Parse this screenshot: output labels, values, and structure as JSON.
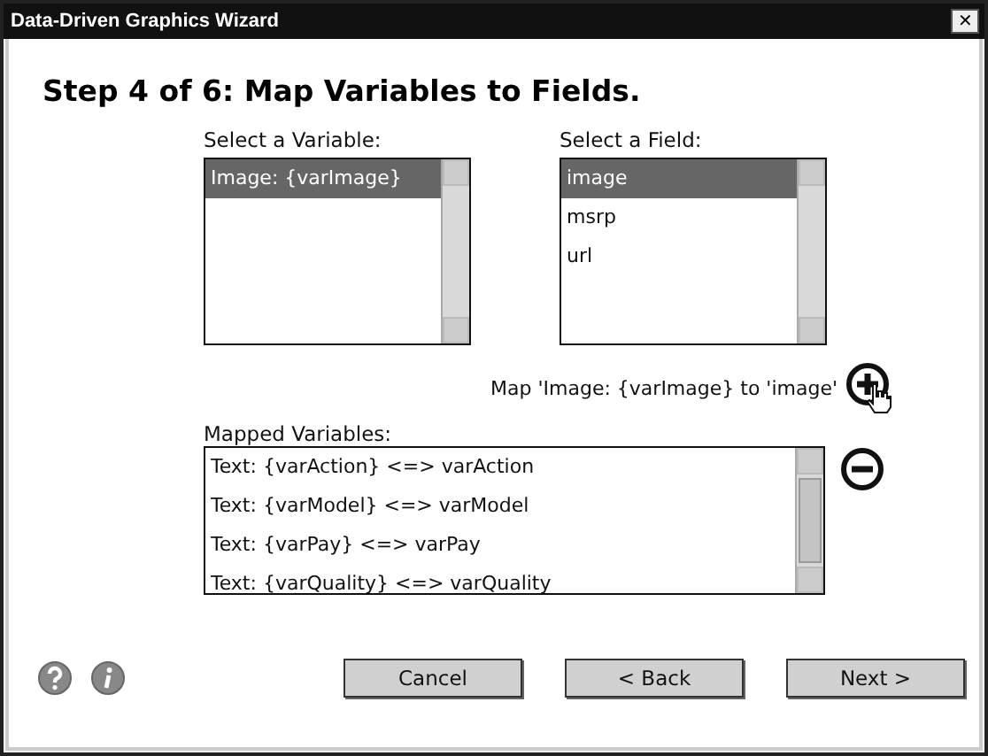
{
  "window": {
    "title": "Data-Driven Graphics Wizard",
    "close": "✕"
  },
  "heading": "Step 4 of 6: Map Variables to Fields.",
  "variables": {
    "label": "Select a Variable:",
    "items": [
      {
        "text": "Image: {varImage}",
        "selected": true
      }
    ]
  },
  "fields": {
    "label": "Select a Field:",
    "items": [
      {
        "text": "image",
        "selected": true
      },
      {
        "text": "msrp",
        "selected": false
      },
      {
        "text": "url",
        "selected": false
      }
    ]
  },
  "map_hint": "Map 'Image: {varImage} to 'image'",
  "mapped": {
    "label": "Mapped Variables:",
    "items": [
      {
        "text": "Text: {varAction} <=> varAction",
        "selected": false
      },
      {
        "text": "Text: {varModel} <=> varModel",
        "selected": false
      },
      {
        "text": "Text: {varPay} <=> varPay",
        "selected": false
      },
      {
        "text": "Text: {varQuality} <=> varQuality",
        "selected": false
      }
    ]
  },
  "buttons": [
    "Cancel",
    "< Back",
    "Next >"
  ]
}
